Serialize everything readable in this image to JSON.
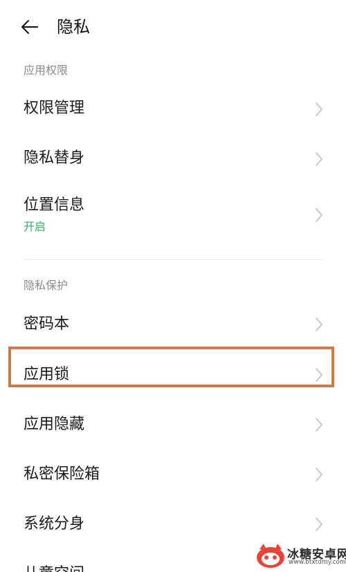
{
  "header": {
    "title": "隐私"
  },
  "sections": [
    {
      "header": "应用权限"
    },
    {
      "header": "隐私保护"
    }
  ],
  "rows": [
    {
      "label": "权限管理"
    },
    {
      "label": "隐私替身"
    },
    {
      "label": "位置信息",
      "sublabel": "开启"
    },
    {
      "label": "密码本"
    },
    {
      "label": "应用锁"
    },
    {
      "label": "应用隐藏"
    },
    {
      "label": "私密保险箱"
    },
    {
      "label": "系统分身"
    },
    {
      "label": "儿童空间"
    }
  ],
  "colors": {
    "status_on": "#2fb36a",
    "highlight": "#d07a45",
    "section_header": "#8a8a8a",
    "chevron": "#c4c4c4"
  },
  "watermark": {
    "text": "冰糖安卓网",
    "url": "www.btxtdmy.com"
  }
}
